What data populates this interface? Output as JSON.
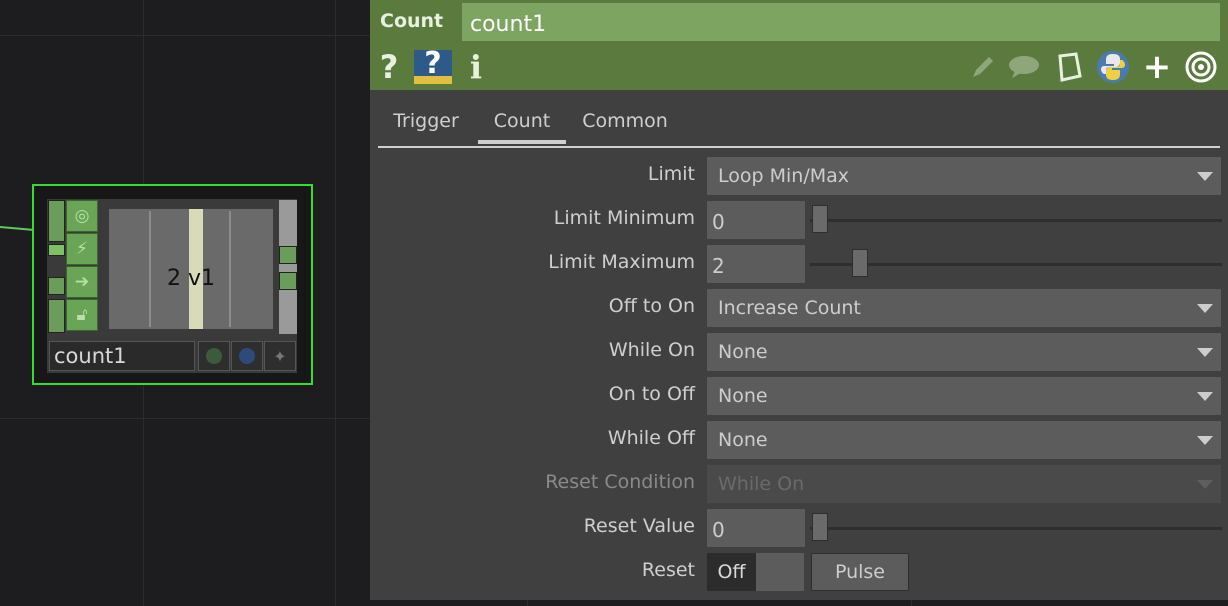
{
  "node": {
    "viewer_label": "2 v1",
    "name": "count1"
  },
  "panel": {
    "op_type": "Count",
    "op_name": "count1",
    "icons": {
      "help": "?",
      "python_help": "?",
      "info": "i"
    },
    "tabs": [
      {
        "label": "Trigger",
        "active": false
      },
      {
        "label": "Count",
        "active": true
      },
      {
        "label": "Common",
        "active": false
      }
    ],
    "params": {
      "limit": {
        "label": "Limit",
        "value": "Loop Min/Max"
      },
      "limit_min": {
        "label": "Limit Minimum",
        "value": "0",
        "slider_fraction": 0.0
      },
      "limit_max": {
        "label": "Limit Maximum",
        "value": "2",
        "slider_fraction": 0.12
      },
      "off_to_on": {
        "label": "Off to On",
        "value": "Increase Count"
      },
      "while_on": {
        "label": "While On",
        "value": "None"
      },
      "on_to_off": {
        "label": "On to Off",
        "value": "None"
      },
      "while_off": {
        "label": "While Off",
        "value": "None"
      },
      "reset_condition": {
        "label": "Reset Condition",
        "value": "While On",
        "disabled": true
      },
      "reset_value": {
        "label": "Reset Value",
        "value": "0",
        "slider_fraction": 0.0
      },
      "reset": {
        "label": "Reset",
        "toggle_state": "Off",
        "pulse_label": "Pulse"
      }
    }
  },
  "colors": {
    "header_green": "#5a7a3e",
    "name_field_green": "#7da461",
    "node_select": "#33dd33",
    "panel_bg": "#404040"
  }
}
